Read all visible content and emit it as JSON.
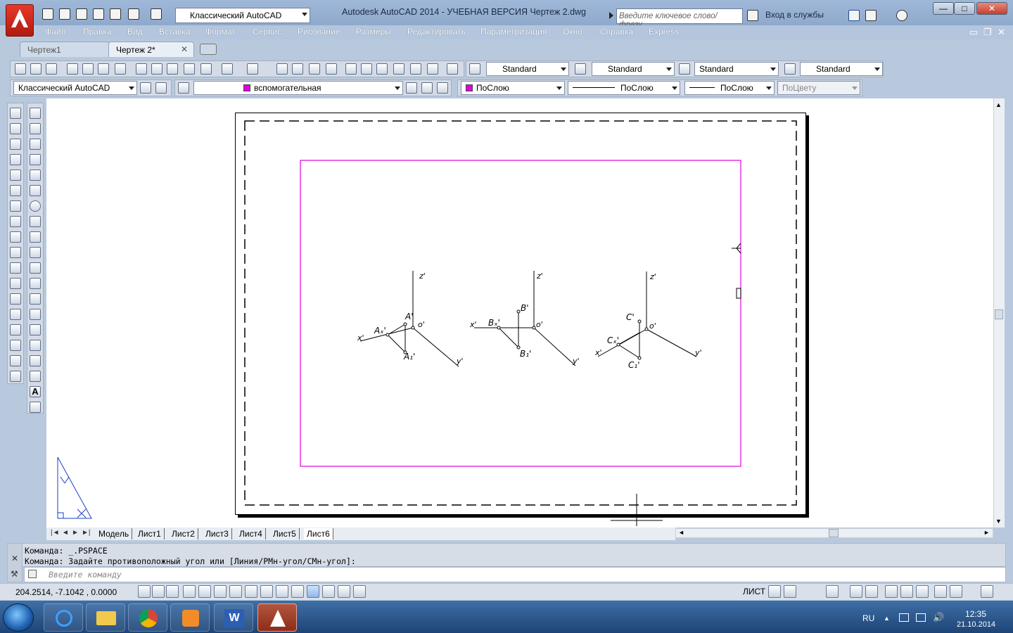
{
  "window": {
    "title": "Autodesk AutoCAD 2014 - УЧЕБНАЯ ВЕРСИЯ     Чертеж 2.dwg",
    "workspace": "Классический AutoCAD",
    "search_placeholder": "Введите ключевое слово/фразу",
    "login": "Вход в службы",
    "minimize": "—",
    "maximize": "□",
    "close": "✕"
  },
  "menu": [
    "Файл",
    "Правка",
    "Вид",
    "Вставка",
    "Формат",
    "Сервис",
    "Рисование",
    "Размеры",
    "Редактировать",
    "Параметризация",
    "Окно",
    "Справка",
    "Express"
  ],
  "doc_tabs": [
    {
      "label": "Чертеж1",
      "close": ""
    },
    {
      "label": "Чертеж 2*",
      "close": "✕"
    }
  ],
  "styles_toolbar": {
    "text_style": "Standard",
    "dim_style": "Standard",
    "table_style": "Standard",
    "mleader_style": "Standard"
  },
  "layers_toolbar": {
    "workspace": "Классический AutoCAD",
    "layer": "вспомогательная",
    "color": "ПоСлою",
    "linetype": "ПоСлою",
    "lineweight": "ПоСлою",
    "plotstyle": "ПоЦвету"
  },
  "drawing": {
    "labels": {
      "z1": "z'",
      "x1": "x'",
      "y1": "y'",
      "o1": "o'",
      "A": "A'",
      "Ax": "Aₓ'",
      "A1": "A₁'",
      "z2": "z'",
      "x2": "x'",
      "y2": "y'",
      "o2": "o'",
      "B": "B'",
      "Bx": "Bₓ'",
      "B1": "B₁'",
      "z3": "z'",
      "x3": "x'",
      "y3": "y'",
      "o3": "o'",
      "C": "C'",
      "Cx": "Cₓ'",
      "C1": "C₁'"
    }
  },
  "layout_tabs": {
    "nav": [
      "|◄",
      "◄",
      "►",
      "►|"
    ],
    "tabs": [
      "Модель",
      "Лист1",
      "Лист2",
      "Лист3",
      "Лист4",
      "Лист5",
      "Лист6"
    ],
    "active": "Лист6"
  },
  "command": {
    "history": [
      "Команда:  _.PSPACE",
      "Команда: Задайте противоположный угол или [Линия/РМн-угол/СМн-угол]:"
    ],
    "placeholder": "Введите команду"
  },
  "status": {
    "coords": "204.2514,  -7.1042  , 0.0000",
    "sheet": "ЛИСТ"
  },
  "taskbar": {
    "lang": "RU",
    "time": "12:35",
    "date": "21.10.2014"
  },
  "colors": {
    "layer_magenta": "#e000e0",
    "autocad_red": "#c2251a"
  }
}
